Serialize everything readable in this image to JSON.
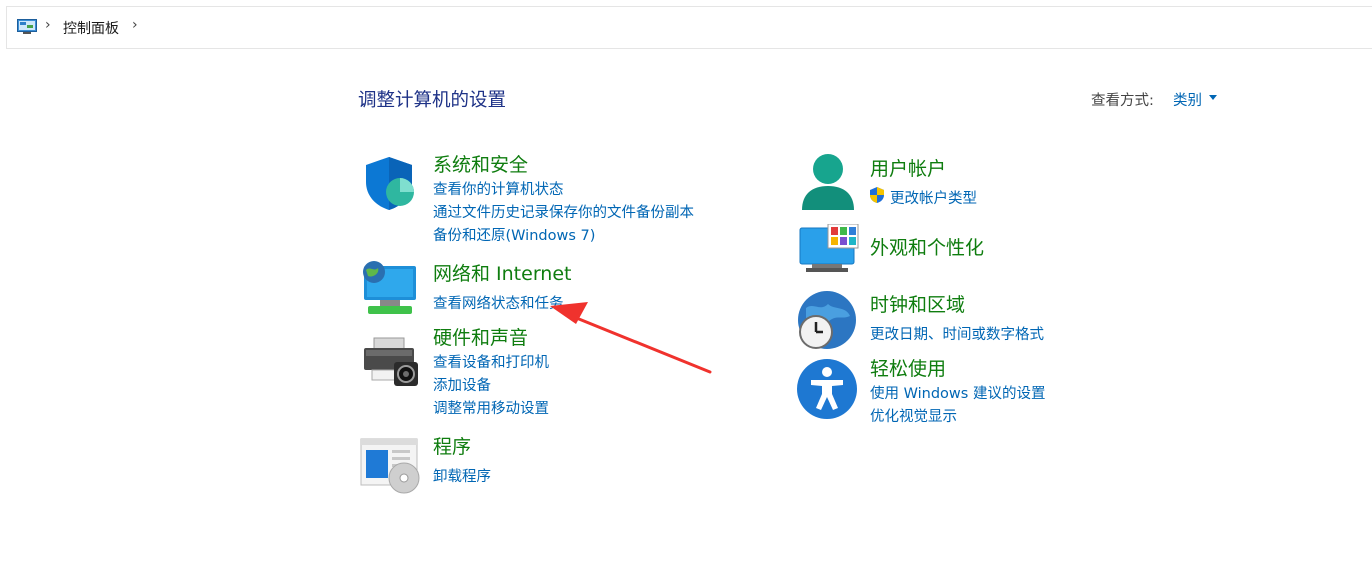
{
  "address_bar": {
    "icon": "control-panel-icon",
    "crumb": "控制面板",
    "separator": "›"
  },
  "page": {
    "title": "调整计算机的设置",
    "view_by_label": "查看方式:",
    "view_by_value": "类别"
  },
  "categories": {
    "system_security": {
      "icon": "shield-icon",
      "title": "系统和安全",
      "links": [
        "查看你的计算机状态",
        "通过文件历史记录保存你的文件备份副本",
        "备份和还原(Windows 7)"
      ]
    },
    "network": {
      "icon": "network-globe-icon",
      "title": "网络和 Internet",
      "links": [
        "查看网络状态和任务"
      ]
    },
    "hardware": {
      "icon": "printer-icon",
      "title": "硬件和声音",
      "links": [
        "查看设备和打印机",
        "添加设备",
        "调整常用移动设置"
      ]
    },
    "programs": {
      "icon": "programs-disc-icon",
      "title": "程序",
      "links": [
        "卸载程序"
      ]
    },
    "user_accounts": {
      "icon": "user-icon",
      "title": "用户帐户",
      "links": [
        "更改帐户类型"
      ],
      "link_icon": "uac-shield-icon"
    },
    "appearance": {
      "icon": "monitor-color-icon",
      "title": "外观和个性化",
      "links": []
    },
    "clock_region": {
      "icon": "clock-globe-icon",
      "title": "时钟和区域",
      "links": [
        "更改日期、时间或数字格式"
      ]
    },
    "ease_of_access": {
      "icon": "accessibility-icon",
      "title": "轻松使用",
      "links": [
        "使用 Windows 建议的设置",
        "优化视觉显示"
      ]
    }
  },
  "annotation": {
    "type": "red-arrow",
    "color": "#f0322d"
  }
}
